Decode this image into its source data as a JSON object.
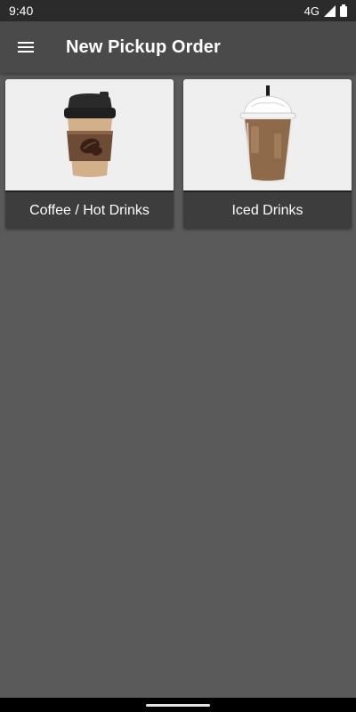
{
  "status_bar": {
    "time": "9:40",
    "network": "4G",
    "icons": [
      "signal-icon",
      "battery-icon"
    ]
  },
  "app_bar": {
    "title": "New Pickup Order",
    "menu_icon": "hamburger-menu-icon"
  },
  "categories": [
    {
      "label": "Coffee / Hot Drinks",
      "image": "hot-coffee-cup-icon"
    },
    {
      "label": "Iced Drinks",
      "image": "iced-drink-cup-icon"
    }
  ],
  "colors": {
    "background": "#5a5a5a",
    "app_bar": "#4a4a4a",
    "status_bar": "#2b2b2b",
    "card_label_bg": "#3d3d3d",
    "card_image_bg": "#efefef"
  }
}
